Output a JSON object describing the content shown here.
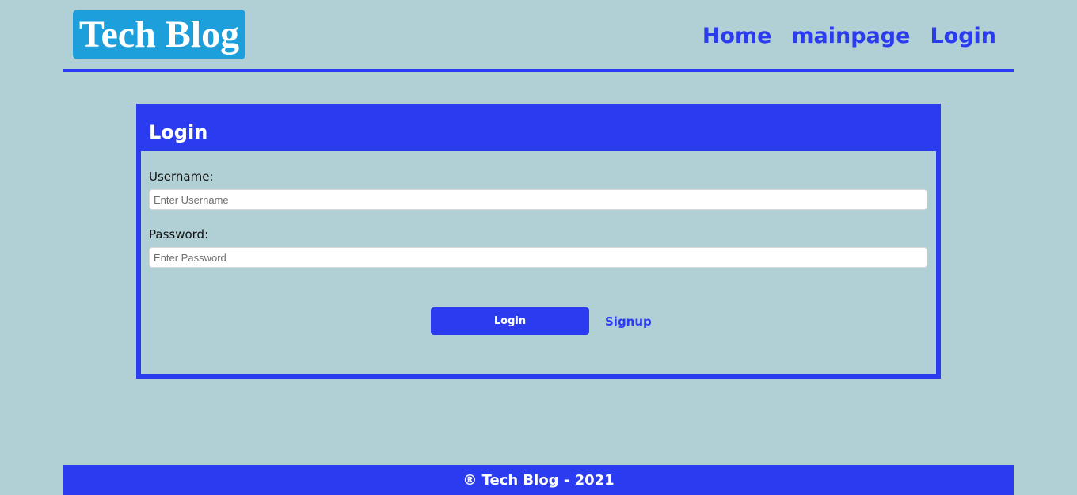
{
  "header": {
    "logo_text": "Tech Blog",
    "nav": [
      {
        "label": "Home"
      },
      {
        "label": "mainpage"
      },
      {
        "label": "Login"
      }
    ]
  },
  "login_form": {
    "title": "Login",
    "username": {
      "label": "Username:",
      "placeholder": "Enter Username",
      "value": ""
    },
    "password": {
      "label": "Password:",
      "placeholder": "Enter Password",
      "value": ""
    },
    "login_button_label": "Login",
    "signup_link_label": "Signup"
  },
  "footer": {
    "text": "® Tech Blog - 2021"
  },
  "colors": {
    "background": "#b0d0d5",
    "primary_blue": "#2b3bf0",
    "logo_background": "#1c9fdb",
    "input_background": "#ffffff"
  }
}
